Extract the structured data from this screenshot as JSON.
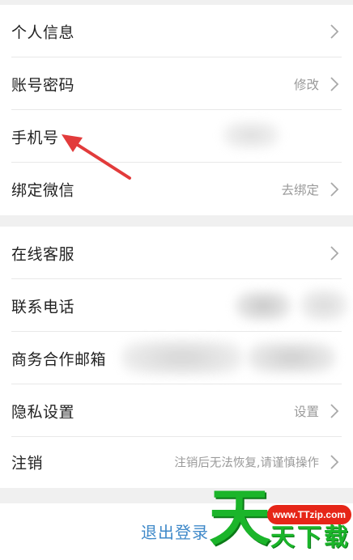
{
  "group1": [
    {
      "label": "个人信息",
      "value": "",
      "chevron": true
    },
    {
      "label": "账号密码",
      "value": "修改",
      "chevron": true
    },
    {
      "label": "手机号",
      "value": "",
      "chevron": false
    },
    {
      "label": "绑定微信",
      "value": "去绑定",
      "chevron": true
    }
  ],
  "group2": [
    {
      "label": "在线客服",
      "value": "",
      "chevron": true
    },
    {
      "label": "联系电话",
      "value": "",
      "chevron": false
    },
    {
      "label": "商务合作邮箱",
      "value": "",
      "chevron": false
    },
    {
      "label": "隐私设置",
      "value": "设置",
      "chevron": true
    },
    {
      "label": "注销",
      "value": "注销后无法恢复,请谨慎操作",
      "chevron": true
    }
  ],
  "logout_label": "退出登录",
  "watermark": {
    "url": "www.TTzip.com",
    "glyph": "天",
    "text": "天下载"
  },
  "annotation": {
    "arrow_color": "#e23b3b"
  },
  "colors": {
    "link": "#3f89c9",
    "watermark_green": "#1bb52a",
    "watermark_red": "#e62618"
  }
}
